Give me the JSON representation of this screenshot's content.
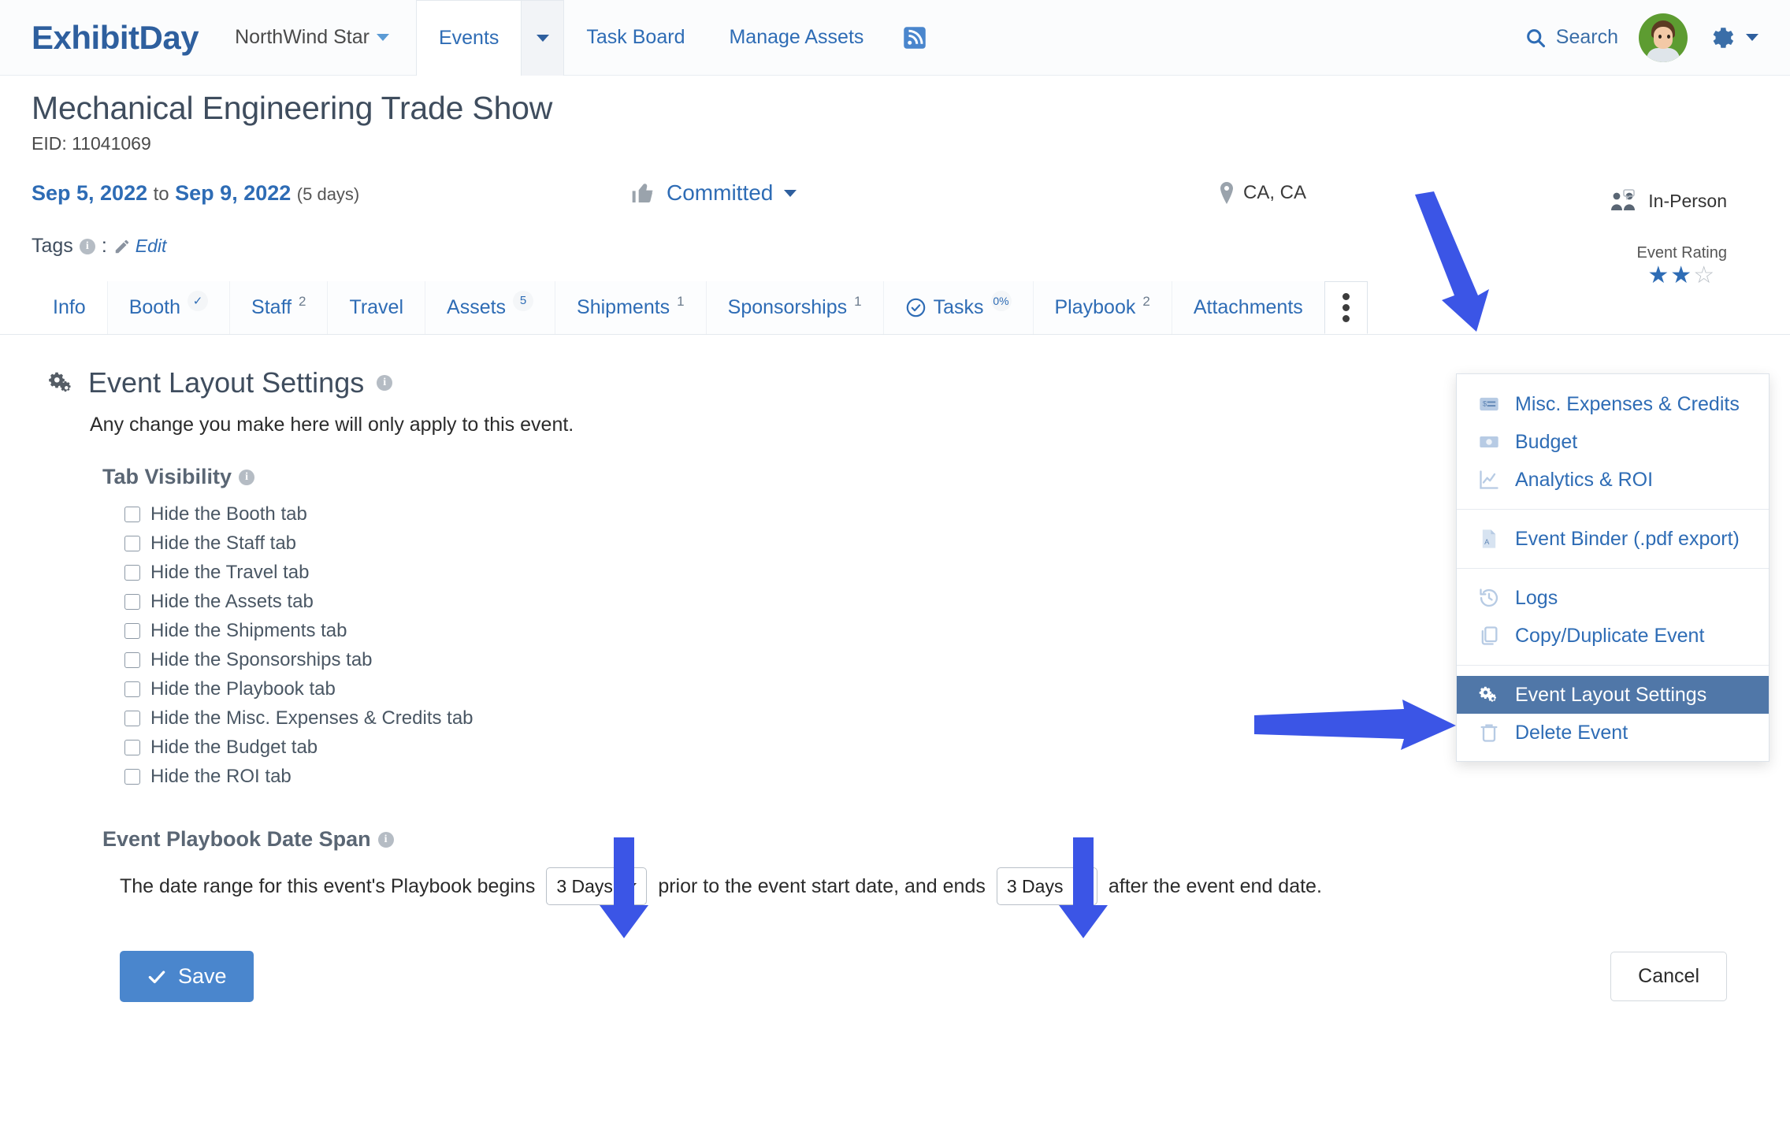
{
  "topnav": {
    "logo_text_1": "Exhibit",
    "logo_text_2": "Day",
    "org_name": "NorthWind Star",
    "tabs": [
      {
        "label": "Events",
        "active": true
      },
      {
        "label": "Task Board",
        "active": false
      },
      {
        "label": "Manage Assets",
        "active": false
      }
    ],
    "rss_icon": "rss-icon",
    "search_label": "Search",
    "search_icon": "search-icon",
    "avatar_icon": "avatar",
    "gear_icon": "gear-icon"
  },
  "event": {
    "title": "Mechanical Engineering Trade Show",
    "eid_label": "EID: 11041069",
    "start_date": "Sep 5, 2022",
    "to_word": "to",
    "end_date": "Sep 9, 2022",
    "duration": "(5 days)",
    "status": "Committed",
    "status_icon": "thumbs-up-icon",
    "location": "CA, CA",
    "location_icon": "map-pin-icon",
    "format": "In-Person",
    "format_icon": "people-icon",
    "rating_label": "Event Rating",
    "rating_value": 2,
    "rating_max": 3,
    "tags_label": "Tags",
    "tags_edit": "Edit",
    "tags_edit_icon": "pencil-icon"
  },
  "event_tabs": [
    {
      "label": "Info",
      "badge": "",
      "badge_type": "none",
      "icon": ""
    },
    {
      "label": "Booth",
      "badge": "✓",
      "badge_type": "circle",
      "icon": ""
    },
    {
      "label": "Staff",
      "badge": "2",
      "badge_type": "sup",
      "icon": ""
    },
    {
      "label": "Travel",
      "badge": "",
      "badge_type": "none",
      "icon": ""
    },
    {
      "label": "Assets",
      "badge": "5",
      "badge_type": "circle",
      "icon": ""
    },
    {
      "label": "Shipments",
      "badge": "1",
      "badge_type": "sup",
      "icon": ""
    },
    {
      "label": "Sponsorships",
      "badge": "1",
      "badge_type": "sup",
      "icon": ""
    },
    {
      "label": "Tasks",
      "badge": "0%",
      "badge_type": "circle",
      "icon": "check-circle-icon"
    },
    {
      "label": "Playbook",
      "badge": "2",
      "badge_type": "sup",
      "icon": ""
    },
    {
      "label": "Attachments",
      "badge": "",
      "badge_type": "none",
      "icon": ""
    }
  ],
  "kebab_menu": {
    "trigger_icon": "kebab-menu-icon",
    "groups": [
      [
        {
          "label": "Misc. Expenses & Credits",
          "icon": "expenses-icon",
          "highlight": false
        },
        {
          "label": "Budget",
          "icon": "money-icon",
          "highlight": false
        },
        {
          "label": "Analytics & ROI",
          "icon": "chart-icon",
          "highlight": false
        }
      ],
      [
        {
          "label": "Event Binder (.pdf export)",
          "icon": "pdf-icon",
          "highlight": false
        }
      ],
      [
        {
          "label": "Logs",
          "icon": "history-icon",
          "highlight": false
        },
        {
          "label": "Copy/Duplicate Event",
          "icon": "copy-icon",
          "highlight": false
        }
      ],
      [
        {
          "label": "Event Layout Settings",
          "icon": "gears-icon",
          "highlight": true
        },
        {
          "label": "Delete Event",
          "icon": "trash-icon",
          "highlight": false
        }
      ]
    ]
  },
  "panel": {
    "title": "Event Layout Settings",
    "title_icon": "gears-icon",
    "subtitle": "Any change you make here will only apply to this event.",
    "tab_visibility_label": "Tab Visibility",
    "checkboxes": [
      {
        "label": "Hide the Booth tab",
        "checked": false
      },
      {
        "label": "Hide the Staff tab",
        "checked": false
      },
      {
        "label": "Hide the Travel tab",
        "checked": false
      },
      {
        "label": "Hide the Assets tab",
        "checked": false
      },
      {
        "label": "Hide the Shipments tab",
        "checked": false
      },
      {
        "label": "Hide the Sponsorships tab",
        "checked": false
      },
      {
        "label": "Hide the Playbook tab",
        "checked": false
      },
      {
        "label": "Hide the Misc. Expenses & Credits tab",
        "checked": false
      },
      {
        "label": "Hide the Budget tab",
        "checked": false
      },
      {
        "label": "Hide the ROI tab",
        "checked": false
      }
    ],
    "date_span_label": "Event Playbook Date Span",
    "date_span_text_1": "The date range for this event's Playbook begins",
    "date_span_select_1": "3 Days",
    "date_span_text_2": "prior to the event start date, and ends",
    "date_span_select_2": "3 Days",
    "date_span_text_3": "after the event end date.",
    "save_label": "Save",
    "save_icon": "check-icon",
    "cancel_label": "Cancel"
  },
  "colors": {
    "accent_blue": "#2e6cb5",
    "save_blue": "#4a86cd",
    "highlight_blue": "#5077a8",
    "arrow_blue": "#3B55E6",
    "avatar_green": "#5d9c31"
  }
}
